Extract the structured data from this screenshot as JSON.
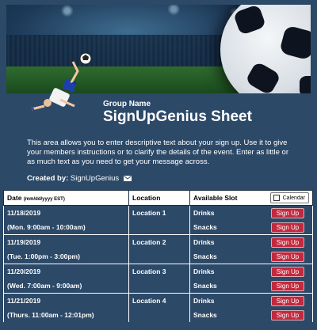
{
  "header": {
    "group_label": "Group Name",
    "title": "SignUpGenius Sheet",
    "description": "This area allows you to enter descriptive text about your sign up. Use it to give your members instructions or to clarify the details of the event. Enter as little or as much text as you need to get your message across.",
    "created_by_label": "Created by:",
    "created_by_name": "SignUpGenius"
  },
  "colors": {
    "background": "#2c4968",
    "signup_button": "#c4283d"
  },
  "table": {
    "headers": {
      "date": "Date",
      "date_format": "(mm/dd/yyyy EST)",
      "location": "Location",
      "slot": "Available Slot",
      "calendar": "Calendar"
    },
    "rows": [
      {
        "date": "11/18/2019",
        "time": "(Mon. 9:00am - 10:00am)",
        "location": "Location 1",
        "slots": [
          {
            "name": "Drinks",
            "button": "Sign Up"
          },
          {
            "name": "Snacks",
            "button": "Sign Up"
          }
        ]
      },
      {
        "date": "11/19/2019",
        "time": "(Tue. 1:00pm - 3:00pm)",
        "location": "Location 2",
        "slots": [
          {
            "name": "Drinks",
            "button": "Sign Up"
          },
          {
            "name": "Snacks",
            "button": "Sign Up"
          }
        ]
      },
      {
        "date": "11/20/2019",
        "time": "(Wed. 7:00am - 9:00am)",
        "location": "Location 3",
        "slots": [
          {
            "name": "Drinks",
            "button": "Sign Up"
          },
          {
            "name": "Snacks",
            "button": "Sign Up"
          }
        ]
      },
      {
        "date": "11/21/2019",
        "time": "(Thurs. 11:00am - 12:01pm)",
        "location": "Location 4",
        "slots": [
          {
            "name": "Drinks",
            "button": "Sign Up"
          },
          {
            "name": "Snacks",
            "button": "Sign Up"
          }
        ]
      }
    ]
  }
}
